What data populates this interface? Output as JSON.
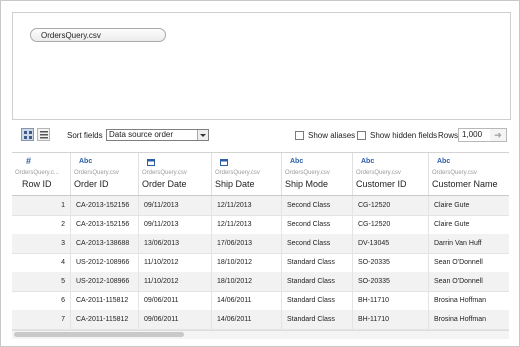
{
  "canvas": {
    "source_label": "OrdersQuery.csv"
  },
  "toolbar": {
    "sort_label": "Sort fields",
    "sort_value": "Data source order",
    "show_aliases": "Show aliases",
    "show_hidden": "Show hidden fields",
    "rows_label": "Rows",
    "rows_value": "1,000",
    "rows_go_icon": "arrow-right-icon",
    "grid_view_icon": "grid-view-icon",
    "list_view_icon": "list-view-icon"
  },
  "columns": [
    {
      "type_icon": "#",
      "type": "number",
      "source": "OrdersQuery.c...",
      "name": "Row ID"
    },
    {
      "type_icon": "Abc",
      "type": "string",
      "source": "OrdersQuery.csv",
      "name": "Order ID"
    },
    {
      "type_icon": "date-icon",
      "type": "date",
      "source": "OrdersQuery.csv",
      "name": "Order Date"
    },
    {
      "type_icon": "date-icon",
      "type": "date",
      "source": "OrdersQuery.csv",
      "name": "Ship Date"
    },
    {
      "type_icon": "Abc",
      "type": "string",
      "source": "OrdersQuery.csv",
      "name": "Ship Mode"
    },
    {
      "type_icon": "Abc",
      "type": "string",
      "source": "OrdersQuery.csv",
      "name": "Customer ID"
    },
    {
      "type_icon": "Abc",
      "type": "string",
      "source": "OrdersQuery.csv",
      "name": "Customer Name"
    }
  ],
  "rows": [
    [
      "1",
      "CA-2013-152156",
      "09/11/2013",
      "12/11/2013",
      "Second Class",
      "CG-12520",
      "Claire Gute"
    ],
    [
      "2",
      "CA-2013-152156",
      "09/11/2013",
      "12/11/2013",
      "Second Class",
      "CG-12520",
      "Claire Gute"
    ],
    [
      "3",
      "CA-2013-138688",
      "13/06/2013",
      "17/06/2013",
      "Second Class",
      "DV-13045",
      "Darrin Van Huff"
    ],
    [
      "4",
      "US-2012-108966",
      "11/10/2012",
      "18/10/2012",
      "Standard Class",
      "SO-20335",
      "Sean O'Donnell"
    ],
    [
      "5",
      "US-2012-108966",
      "11/10/2012",
      "18/10/2012",
      "Standard Class",
      "SO-20335",
      "Sean O'Donnell"
    ],
    [
      "6",
      "CA-2011-115812",
      "09/06/2011",
      "14/06/2011",
      "Standard Class",
      "BH-11710",
      "Brosina Hoffman"
    ],
    [
      "7",
      "CA-2011-115812",
      "09/06/2011",
      "14/06/2011",
      "Standard Class",
      "BH-11710",
      "Brosina Hoffman"
    ]
  ]
}
